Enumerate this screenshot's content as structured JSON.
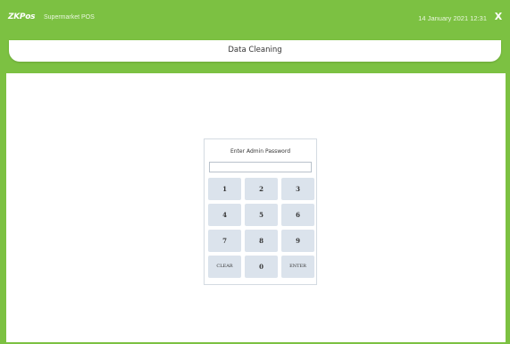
{
  "app": {
    "logo": "ZKPos",
    "title": "Supermarket POS",
    "datetime": "14 January 2021 12:31",
    "close_label": "X"
  },
  "header": {
    "page_title": "Data Cleaning"
  },
  "dialog": {
    "title": "Enter Admin Password",
    "password_value": "",
    "keys": [
      "1",
      "2",
      "3",
      "4",
      "5",
      "6",
      "7",
      "8",
      "9",
      "CLEAR",
      "0",
      "ENTER"
    ]
  },
  "colors": {
    "accent": "#7cc142",
    "key_background": "#dbe3ec",
    "panel_border": "#d4dbe2"
  }
}
